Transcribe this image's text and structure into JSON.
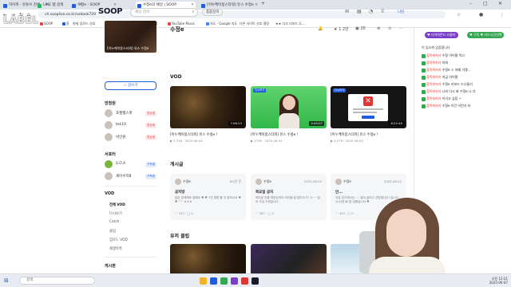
{
  "browser": {
    "tabs": [
      {
        "label": "하이퍼 - 유튜브 검색"
      },
      {
        "label": "LINE 탭 검색"
      },
      {
        "label": "수정e - SOOP"
      },
      {
        "label": "수정e의 채널 | SOOP"
      },
      {
        "label": "[이누케이몽스타워] 유스 수정e"
      }
    ],
    "url": "ch.sooplive.co.kr/sodook729",
    "bookmarks": [
      "SOOP",
      "홈",
      "현재 업로드 선호",
      "네이버",
      "에펙 이지",
      "채널",
      "YouTube Music",
      "지도 - Google 지도",
      "다른 사이트 선호 결정",
      "★★ 다크 리포드 도..."
    ]
  },
  "watermark": "LABEL",
  "site": {
    "logo": "SOOP",
    "search_placeholder": "채널 검색",
    "combo_button": "통합검색",
    "login": "나린",
    "channel_name": "수정e",
    "stats": {
      "followers": "1.2만",
      "vods": "26"
    },
    "sidebar": {
      "thumb_caption": "[이누케이몽스타워] 유스 수정e",
      "button": "☆ 글쓰기",
      "friends_title": "방청원",
      "friends": [
        {
          "name": "포켓펭스팟",
          "badge": "방송중"
        },
        {
          "name": "tek10",
          "badge": "방송중"
        },
        {
          "name": "비인원",
          "badge": "방송중"
        }
      ],
      "subs_title": "서포터",
      "subs": [
        {
          "name": "S.O.A",
          "badge": "구독중"
        },
        {
          "name": "세이수지B",
          "badge": "구독중"
        }
      ],
      "vod_title": "VOD",
      "vod_menu": [
        "전체 VOD",
        "다시보기",
        "Catch",
        "클립",
        "업로드 VOD",
        "재생목록"
      ],
      "board_title": "게시판"
    },
    "vod": {
      "title": "VOD",
      "items": [
        {
          "title": "[이누케이몽스타워] 유스 수정e !",
          "views": "3,748",
          "date": "2025-06-04",
          "duration": "7:08:23",
          "tag": ""
        },
        {
          "title": "[이누케이몽스타워] 유스 수정e !",
          "views": "1799",
          "date": "2025-06-04",
          "duration": "4:45:07",
          "tag": "다시보기"
        },
        {
          "title": "[이누케이몽스타워] 유스 수정e !",
          "views": "3,079",
          "date": "2025-06-03",
          "duration": "6:22:40",
          "tag": "다시보기"
        }
      ]
    },
    "board": {
      "title": "게시글",
      "posts": [
        {
          "author": "수정e",
          "date": "6시간 전",
          "title": "공지방",
          "body": "많은 분께해요 잘해요 ♥ ♥ 7년 편합 할 것 잘하시요 ♥ ♥ ^^ ㅎㅎㅎ",
          "likes": "103",
          "comments": "0"
        },
        {
          "author": "수정e",
          "date": "2025-06-03",
          "title": "목요일 공지",
          "body": "여러분 이틀 재밌었어요 미션을 잘 알아두기? 시~~분이 조금 드렸습니다",
          "likes": "387",
          "comments": "3"
        },
        {
          "author": "수정e",
          "date": "2025-06-02",
          "title": "안...",
          "body": "지금 감기에서는..... 절대 굴리고 선방합니다! 입니다 수시(방)로 말 입했습니다 ♥",
          "likes": "433",
          "comments": "0"
        }
      ]
    },
    "clips": {
      "title": "유저 클립"
    }
  },
  "chat": {
    "heart_label": "♥ 다이아몬드 사용자",
    "green_label": "♥ 구독 ♥ 카드시간선택",
    "notice": "이 업소에 입장합니다",
    "lines": [
      {
        "nick": "참목위저카",
        "text": "수정 아이템 먹고"
      },
      {
        "nick": "참목위저카",
        "text": "하피"
      },
      {
        "nick": "참목위저카",
        "text": "수정e ㅎ 아예 가겠..."
      },
      {
        "nick": "참목위저카",
        "text": "지금 아이템"
      },
      {
        "nick": "참목위저카",
        "text": "수정e 키보드 드나들기"
      },
      {
        "nick": "참목위저카",
        "text": "나의 다시 봐 수정e 나 다"
      },
      {
        "nick": "참목위저카",
        "text": "이기고 싶음 ~"
      },
      {
        "nick": "참목위저카",
        "text": "수정e 이건 이런가 타"
      }
    ]
  },
  "taskbar": {
    "search_placeholder": "검색",
    "time": "오전 12:21",
    "date": "2025-06-07"
  }
}
